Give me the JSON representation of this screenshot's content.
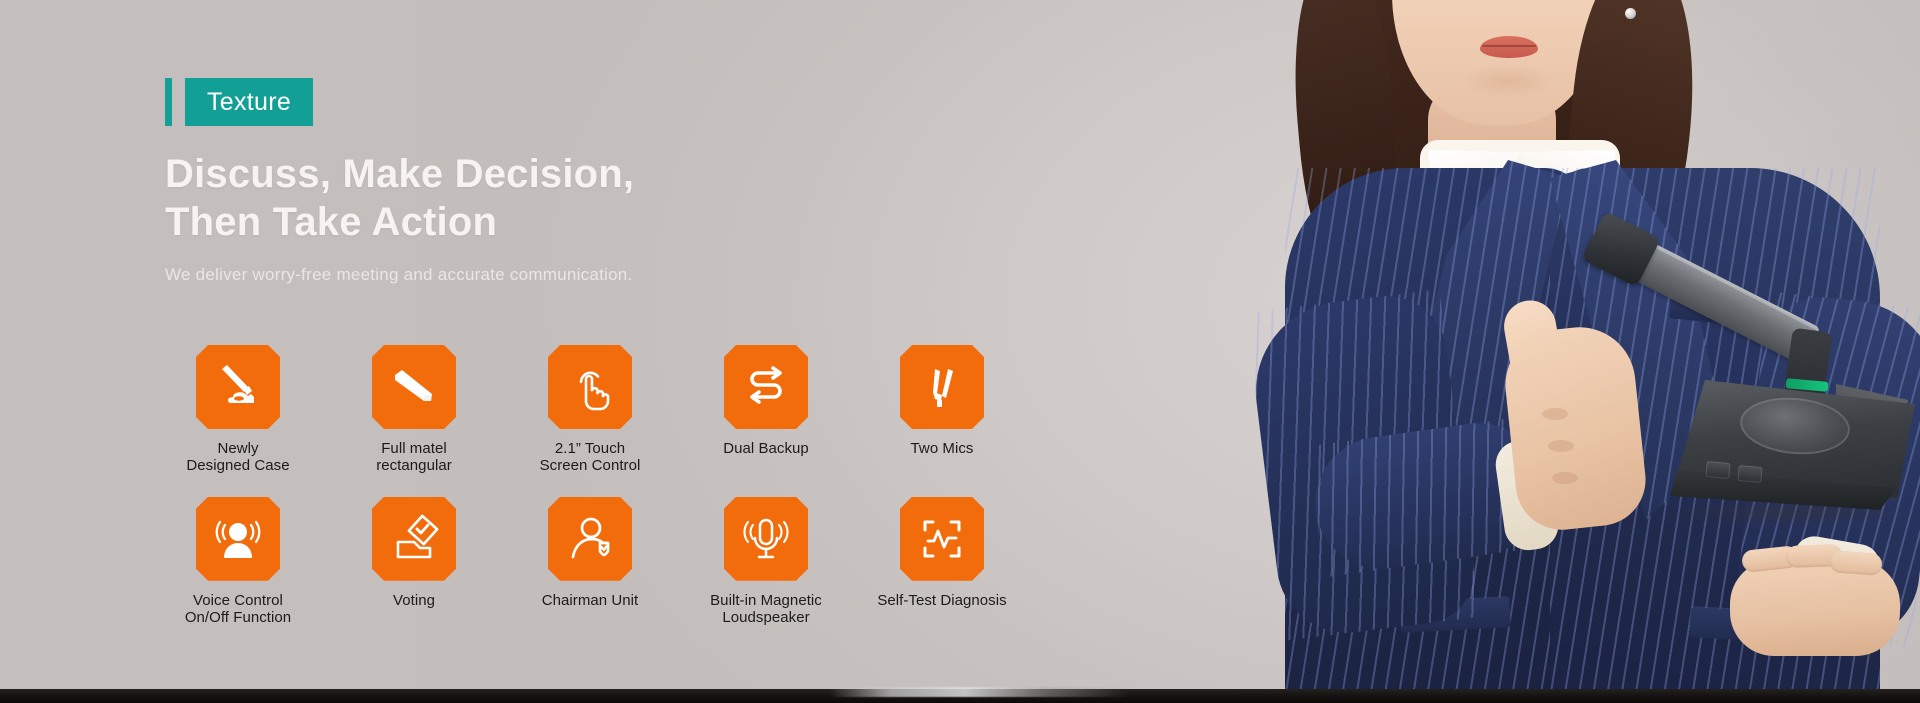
{
  "theme": {
    "accent_teal": "#12a096",
    "accent_orange": "#f36c0b",
    "background": "#cbc6c6",
    "headline_color": "#f6f3f2",
    "label_color": "#1c1c1c"
  },
  "hero": {
    "badge_label": "Texture",
    "headline_line1": "Discuss, Make Decision,",
    "headline_line2": "Then Take Action",
    "subheadline": "We deliver worry-free meeting and accurate communication."
  },
  "features": {
    "row1": [
      {
        "icon": "gooseneck-microphone-icon",
        "label_line1": "Newly",
        "label_line2": "Designed Case"
      },
      {
        "icon": "metal-bar-icon",
        "label_line1": "Full matel",
        "label_line2": "rectangular"
      },
      {
        "icon": "touch-hand-icon",
        "label_line1": "2.1” Touch",
        "label_line2": "Screen Control"
      },
      {
        "icon": "dual-backup-arrows-icon",
        "label_line1": "Dual Backup",
        "label_line2": ""
      },
      {
        "icon": "two-microphones-icon",
        "label_line1": "Two Mics",
        "label_line2": ""
      }
    ],
    "row2": [
      {
        "icon": "voice-control-person-icon",
        "label_line1": "Voice Control",
        "label_line2": "On/Off Function"
      },
      {
        "icon": "ballot-box-icon",
        "label_line1": "Voting",
        "label_line2": ""
      },
      {
        "icon": "chairman-person-check-icon",
        "label_line1": "Chairman Unit",
        "label_line2": ""
      },
      {
        "icon": "magnetic-loudspeaker-mic-icon",
        "label_line1": "Built-in Magnetic",
        "label_line2": "Loudspeaker"
      },
      {
        "icon": "self-test-waveform-scan-icon",
        "label_line1": "Self-Test Diagnosis",
        "label_line2": ""
      }
    ]
  },
  "photo": {
    "alt_subject": "businesswoman-holding-conference-microphone-unit",
    "gesture": "thumbs-up"
  }
}
